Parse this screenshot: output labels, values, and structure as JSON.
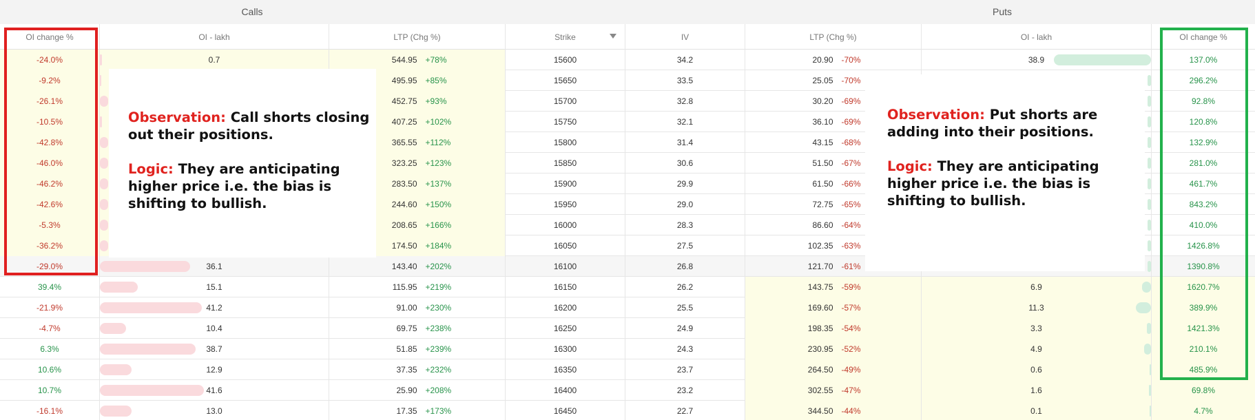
{
  "groups": {
    "calls": "Calls",
    "puts": "Puts"
  },
  "headers": {
    "call_oi_change": "OI change %",
    "call_oi": "OI - lakh",
    "call_ltp": "LTP (Chg %)",
    "strike": "Strike",
    "iv": "IV",
    "put_ltp": "LTP (Chg %)",
    "put_oi": "OI - lakh",
    "put_oi_change": "OI change %"
  },
  "rows": [
    {
      "c_oich": "-24.0%",
      "c_oi": "0.7",
      "c_oi_frac": 0.01,
      "c_ltp": "544.95",
      "c_chg": "+78%",
      "strike": "15600",
      "iv": "34.2",
      "p_ltp": "20.90",
      "p_chg": "-70%",
      "p_oi": "38.9",
      "p_oi_frac": 0.88,
      "p_oich": "137.0%"
    },
    {
      "c_oich": "-9.2%",
      "c_oi": "",
      "c_oi_frac": 0,
      "c_ltp": "495.95",
      "c_chg": "+85%",
      "strike": "15650",
      "iv": "33.5",
      "p_ltp": "25.05",
      "p_chg": "-70%",
      "p_oi": "",
      "p_oi_frac": 0.03,
      "p_oich": "296.2%"
    },
    {
      "c_oich": "-26.1%",
      "c_oi": "",
      "c_oi_frac": 0.04,
      "c_ltp": "452.75",
      "c_chg": "+93%",
      "strike": "15700",
      "iv": "32.8",
      "p_ltp": "30.20",
      "p_chg": "-69%",
      "p_oi": "",
      "p_oi_frac": 0.03,
      "p_oich": "92.8%"
    },
    {
      "c_oich": "-10.5%",
      "c_oi": "",
      "c_oi_frac": 0.01,
      "c_ltp": "407.25",
      "c_chg": "+102%",
      "strike": "15750",
      "iv": "32.1",
      "p_ltp": "36.10",
      "p_chg": "-69%",
      "p_oi": "",
      "p_oi_frac": 0.03,
      "p_oich": "120.8%"
    },
    {
      "c_oich": "-42.8%",
      "c_oi": "",
      "c_oi_frac": 0.04,
      "c_ltp": "365.55",
      "c_chg": "+112%",
      "strike": "15800",
      "iv": "31.4",
      "p_ltp": "43.15",
      "p_chg": "-68%",
      "p_oi": "",
      "p_oi_frac": 0.03,
      "p_oich": "132.9%"
    },
    {
      "c_oich": "-46.0%",
      "c_oi": "",
      "c_oi_frac": 0.04,
      "c_ltp": "323.25",
      "c_chg": "+123%",
      "strike": "15850",
      "iv": "30.6",
      "p_ltp": "51.50",
      "p_chg": "-67%",
      "p_oi": "",
      "p_oi_frac": 0.03,
      "p_oich": "281.0%"
    },
    {
      "c_oich": "-46.2%",
      "c_oi": "",
      "c_oi_frac": 0.04,
      "c_ltp": "283.50",
      "c_chg": "+137%",
      "strike": "15900",
      "iv": "29.9",
      "p_ltp": "61.50",
      "p_chg": "-66%",
      "p_oi": "",
      "p_oi_frac": 0.03,
      "p_oich": "461.7%"
    },
    {
      "c_oich": "-42.6%",
      "c_oi": "",
      "c_oi_frac": 0.04,
      "c_ltp": "244.60",
      "c_chg": "+150%",
      "strike": "15950",
      "iv": "29.0",
      "p_ltp": "72.75",
      "p_chg": "-65%",
      "p_oi": "",
      "p_oi_frac": 0.03,
      "p_oich": "843.2%"
    },
    {
      "c_oich": "-5.3%",
      "c_oi": "",
      "c_oi_frac": 0.04,
      "c_ltp": "208.65",
      "c_chg": "+166%",
      "strike": "16000",
      "iv": "28.3",
      "p_ltp": "86.60",
      "p_chg": "-64%",
      "p_oi": "",
      "p_oi_frac": 0.03,
      "p_oich": "410.0%"
    },
    {
      "c_oich": "-36.2%",
      "c_oi": "",
      "c_oi_frac": 0.04,
      "c_ltp": "174.50",
      "c_chg": "+184%",
      "strike": "16050",
      "iv": "27.5",
      "p_ltp": "102.35",
      "p_chg": "-63%",
      "p_oi": "",
      "p_oi_frac": 0.03,
      "p_oich": "1426.8%"
    },
    {
      "c_oich": "-29.0%",
      "c_oi": "36.1",
      "c_oi_frac": 0.45,
      "c_ltp": "143.40",
      "c_chg": "+202%",
      "strike": "16100",
      "iv": "26.8",
      "p_ltp": "121.70",
      "p_chg": "-61%",
      "p_oi": "",
      "p_oi_frac": 0.03,
      "p_oich": "1390.8%",
      "atm": true
    },
    {
      "c_oich": "39.4%",
      "c_oi": "15.1",
      "c_oi_frac": 0.19,
      "c_ltp": "115.95",
      "c_chg": "+219%",
      "strike": "16150",
      "iv": "26.2",
      "p_ltp": "143.75",
      "p_chg": "-59%",
      "p_oi": "6.9",
      "p_oi_frac": 0.08,
      "p_oich": "1620.7%"
    },
    {
      "c_oich": "-21.9%",
      "c_oi": "41.2",
      "c_oi_frac": 0.51,
      "c_ltp": "91.00",
      "c_chg": "+230%",
      "strike": "16200",
      "iv": "25.5",
      "p_ltp": "169.60",
      "p_chg": "-57%",
      "p_oi": "11.3",
      "p_oi_frac": 0.14,
      "p_oich": "389.9%"
    },
    {
      "c_oich": "-4.7%",
      "c_oi": "10.4",
      "c_oi_frac": 0.13,
      "c_ltp": "69.75",
      "c_chg": "+238%",
      "strike": "16250",
      "iv": "24.9",
      "p_ltp": "198.35",
      "p_chg": "-54%",
      "p_oi": "3.3",
      "p_oi_frac": 0.04,
      "p_oich": "1421.3%"
    },
    {
      "c_oich": "6.3%",
      "c_oi": "38.7",
      "c_oi_frac": 0.48,
      "c_ltp": "51.85",
      "c_chg": "+239%",
      "strike": "16300",
      "iv": "24.3",
      "p_ltp": "230.95",
      "p_chg": "-52%",
      "p_oi": "4.9",
      "p_oi_frac": 0.06,
      "p_oich": "210.1%"
    },
    {
      "c_oich": "10.6%",
      "c_oi": "12.9",
      "c_oi_frac": 0.16,
      "c_ltp": "37.35",
      "c_chg": "+232%",
      "strike": "16350",
      "iv": "23.7",
      "p_ltp": "264.50",
      "p_chg": "-49%",
      "p_oi": "0.6",
      "p_oi_frac": 0.01,
      "p_oich": "485.9%"
    },
    {
      "c_oich": "10.7%",
      "c_oi": "41.6",
      "c_oi_frac": 0.52,
      "c_ltp": "25.90",
      "c_chg": "+208%",
      "strike": "16400",
      "iv": "23.2",
      "p_ltp": "302.55",
      "p_chg": "-47%",
      "p_oi": "1.6",
      "p_oi_frac": 0.02,
      "p_oich": "69.8%"
    },
    {
      "c_oich": "-16.1%",
      "c_oi": "13.0",
      "c_oi_frac": 0.16,
      "c_ltp": "17.35",
      "c_chg": "+173%",
      "strike": "16450",
      "iv": "22.7",
      "p_ltp": "344.50",
      "p_chg": "-44%",
      "p_oi": "0.1",
      "p_oi_frac": 0.01,
      "p_oich": "4.7%"
    }
  ],
  "annotations": {
    "calls": {
      "obs_label": "Observation:",
      "obs_text": " Call shorts closing out their positions.",
      "logic_label": "Logic:",
      "logic_text": " They are anticipating higher price i.e. the bias is shifting to bullish."
    },
    "puts": {
      "obs_label": "Observation:",
      "obs_text": " Put shorts are adding into their positions.",
      "logic_label": "Logic:",
      "logic_text": " They are anticipating higher price i.e. the bias is shifting to bullish."
    }
  },
  "colors": {
    "negative": "#c0392b",
    "positive": "#27934a",
    "itm_highlight": "#fdfde6",
    "call_bar": "#fadadd",
    "put_bar": "#d2eedd",
    "call_outline": "#e02020",
    "put_outline": "#22b14c",
    "annotation_keyword": "#e0231f"
  }
}
